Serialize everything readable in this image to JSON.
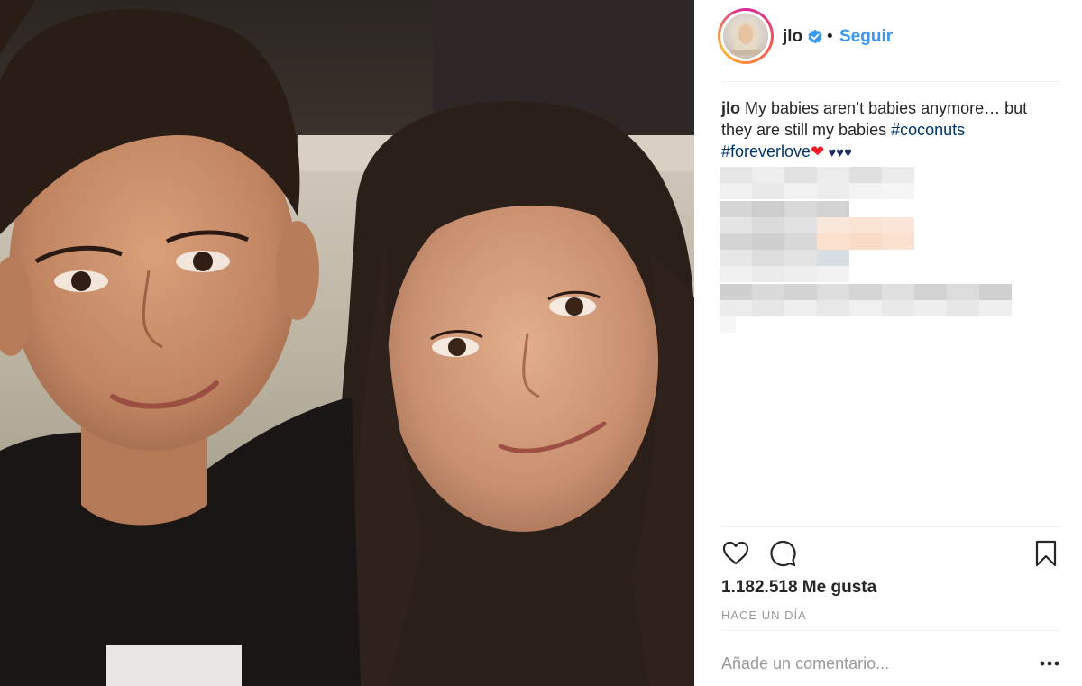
{
  "header": {
    "username": "jlo",
    "separator": "•",
    "follow_label": "Seguir"
  },
  "caption": {
    "username": "jlo",
    "text": " My babies aren’t babies anymore… but they are still my babies ",
    "hashtag_1": "#coconuts",
    "hashtag_2": "#foreverlove",
    "heart": "❤",
    "hearts": " ♥♥♥"
  },
  "actions": {
    "like_icon": "heart-outline-icon",
    "comment_icon": "speech-bubble-icon",
    "save_icon": "bookmark-icon"
  },
  "likes_text": "1.182.518 Me gusta",
  "timestamp": "HACE UN DÍA",
  "comment": {
    "placeholder": "Añade un comentario...",
    "more_icon": "ellipsis-icon"
  },
  "colors": {
    "link_blue": "#3897f0",
    "hashtag_navy": "#003569",
    "muted_gray": "#999999",
    "text_dark": "#262626"
  }
}
